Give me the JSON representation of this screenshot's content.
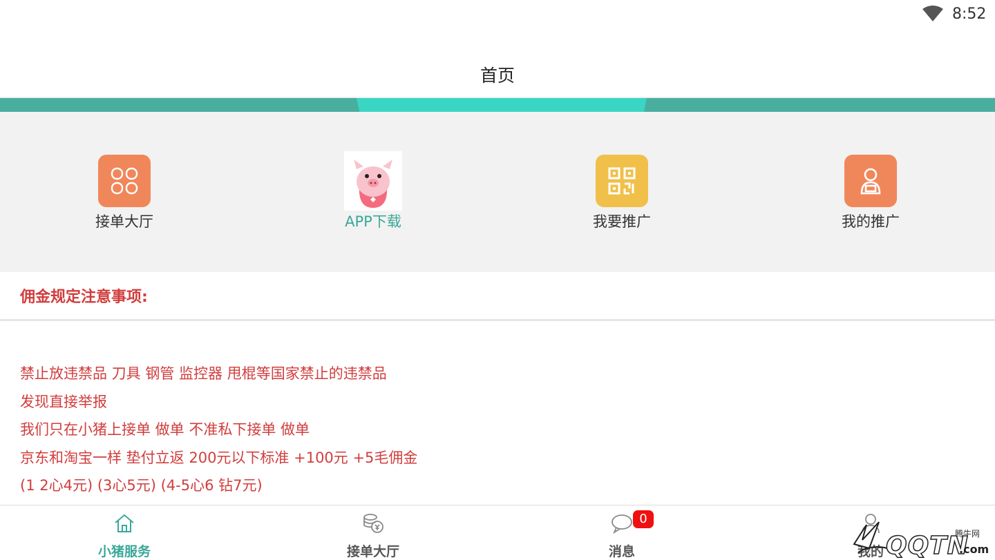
{
  "status_bar": {
    "time": "8:52"
  },
  "header": {
    "title": "首页"
  },
  "colors": {
    "teal": "#4aae9f",
    "teal_highlight": "#3ad6c3",
    "red_text": "#d13d3d",
    "orange": "#f0875a",
    "yellow": "#f0c04a",
    "badge_red": "#ee1111"
  },
  "quick_menu": [
    {
      "label": "接单大厅",
      "icon": "clover-icon"
    },
    {
      "label": "APP下载",
      "icon": "pig-image"
    },
    {
      "label": "我要推广",
      "icon": "qr-code-icon"
    },
    {
      "label": "我的推广",
      "icon": "user-icon"
    }
  ],
  "notice": {
    "title": "佣金规定注意事项:",
    "lines": [
      "禁止放违禁品 刀具 钢管 监控器 甩棍等国家禁止的违禁品",
      "发现直接举报",
      "我们只在小猪上接单 做单 不准私下接单 做单",
      "京东和淘宝一样 垫付立返 200元以下标准 +100元 +5毛佣金",
      "(1 2心4元) (3心5元) (4-5心6 钻7元)"
    ]
  },
  "bottom_nav": [
    {
      "label": "小猪服务",
      "icon": "home-icon",
      "active": true
    },
    {
      "label": "接单大厅",
      "icon": "coins-icon",
      "active": false
    },
    {
      "label": "消息",
      "icon": "chat-icon",
      "active": false,
      "badge": "0"
    },
    {
      "label": "我的",
      "icon": "person-icon",
      "active": false
    }
  ],
  "watermark": {
    "small": "腾牛网",
    "text": "QQTN",
    "suffix": ".com"
  }
}
